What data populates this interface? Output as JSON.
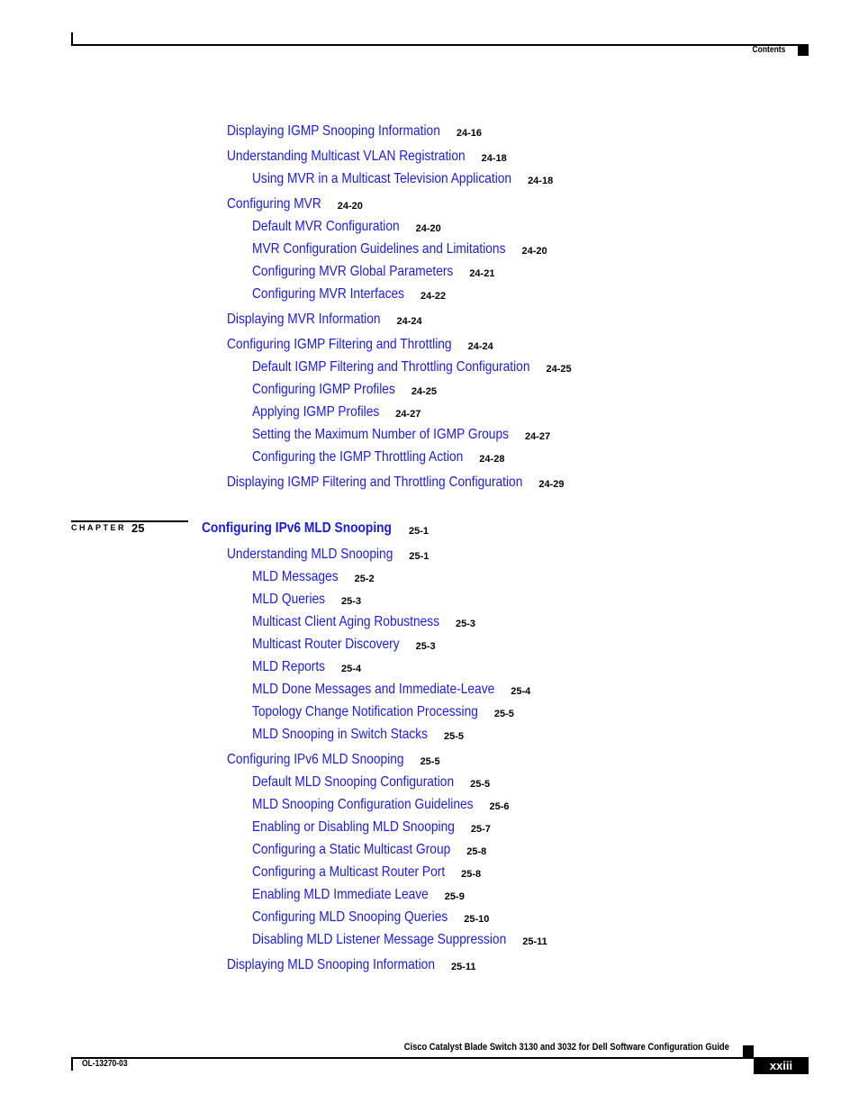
{
  "header": {
    "section": "Contents"
  },
  "chapter": {
    "label": "CHAPTER",
    "number": "25",
    "title": "Configuring IPv6 MLD Snooping",
    "page": "25-1"
  },
  "entries": [
    {
      "level": 1,
      "title": "Displaying IGMP Snooping Information",
      "page": "24-16"
    },
    {
      "level": 1,
      "title": "Understanding Multicast VLAN Registration",
      "page": "24-18"
    },
    {
      "level": 2,
      "title": "Using MVR in a Multicast Television Application",
      "page": "24-18"
    },
    {
      "level": 1,
      "title": "Configuring MVR",
      "page": "24-20"
    },
    {
      "level": 2,
      "title": "Default MVR Configuration",
      "page": "24-20"
    },
    {
      "level": 2,
      "title": "MVR Configuration Guidelines and Limitations",
      "page": "24-20"
    },
    {
      "level": 2,
      "title": "Configuring MVR Global Parameters",
      "page": "24-21"
    },
    {
      "level": 2,
      "title": "Configuring MVR Interfaces",
      "page": "24-22"
    },
    {
      "level": 1,
      "title": "Displaying MVR Information",
      "page": "24-24"
    },
    {
      "level": 1,
      "title": "Configuring IGMP Filtering and Throttling",
      "page": "24-24"
    },
    {
      "level": 2,
      "title": "Default IGMP Filtering and Throttling Configuration",
      "page": "24-25"
    },
    {
      "level": 2,
      "title": "Configuring IGMP Profiles",
      "page": "24-25"
    },
    {
      "level": 2,
      "title": "Applying IGMP Profiles",
      "page": "24-27"
    },
    {
      "level": 2,
      "title": "Setting the Maximum Number of IGMP Groups",
      "page": "24-27"
    },
    {
      "level": 2,
      "title": "Configuring the IGMP Throttling Action",
      "page": "24-28"
    },
    {
      "level": 1,
      "title": "Displaying IGMP Filtering and Throttling Configuration",
      "page": "24-29"
    },
    {
      "level": 1,
      "title": "Understanding MLD Snooping",
      "page": "25-1"
    },
    {
      "level": 2,
      "title": "MLD Messages",
      "page": "25-2"
    },
    {
      "level": 2,
      "title": "MLD Queries",
      "page": "25-3"
    },
    {
      "level": 2,
      "title": "Multicast Client Aging Robustness",
      "page": "25-3"
    },
    {
      "level": 2,
      "title": "Multicast Router Discovery",
      "page": "25-3"
    },
    {
      "level": 2,
      "title": "MLD Reports",
      "page": "25-4"
    },
    {
      "level": 2,
      "title": "MLD Done Messages and Immediate-Leave",
      "page": "25-4"
    },
    {
      "level": 2,
      "title": "Topology Change Notification Processing",
      "page": "25-5"
    },
    {
      "level": 2,
      "title": "MLD Snooping in Switch Stacks",
      "page": "25-5"
    },
    {
      "level": 1,
      "title": "Configuring IPv6 MLD Snooping",
      "page": "25-5"
    },
    {
      "level": 2,
      "title": "Default MLD Snooping Configuration",
      "page": "25-5"
    },
    {
      "level": 2,
      "title": "MLD Snooping Configuration Guidelines",
      "page": "25-6"
    },
    {
      "level": 2,
      "title": "Enabling or Disabling MLD Snooping",
      "page": "25-7"
    },
    {
      "level": 2,
      "title": "Configuring a Static Multicast Group",
      "page": "25-8"
    },
    {
      "level": 2,
      "title": "Configuring a Multicast Router Port",
      "page": "25-8"
    },
    {
      "level": 2,
      "title": "Enabling MLD Immediate Leave",
      "page": "25-9"
    },
    {
      "level": 2,
      "title": "Configuring MLD Snooping Queries",
      "page": "25-10"
    },
    {
      "level": 2,
      "title": "Disabling MLD Listener Message Suppression",
      "page": "25-11"
    },
    {
      "level": 1,
      "title": "Displaying MLD Snooping Information",
      "page": "25-11"
    }
  ],
  "footer": {
    "guide_title": "Cisco Catalyst Blade Switch 3130 and 3032 for Dell Software Configuration Guide",
    "doc_number": "OL-13270-03",
    "page_number": "xxiii"
  }
}
